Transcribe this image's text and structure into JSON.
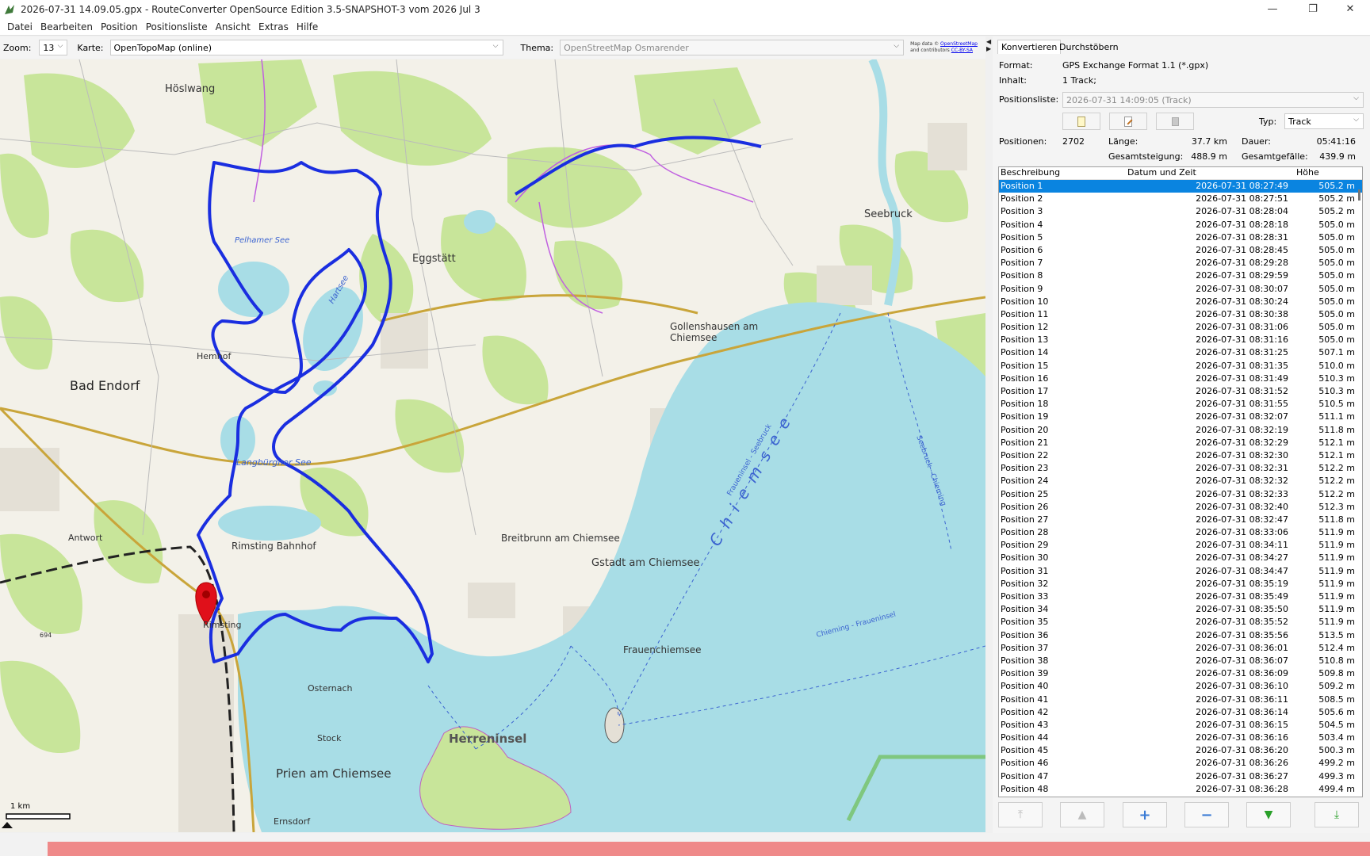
{
  "window": {
    "title": "2026-07-31 14.09.05.gpx - RouteConverter OpenSource Edition 3.5-SNAPSHOT-3 vom 2026 Jul 3",
    "minimize": "—",
    "maximize": "❐",
    "close": "✕"
  },
  "menu": [
    "Datei",
    "Bearbeiten",
    "Position",
    "Positionsliste",
    "Ansicht",
    "Extras",
    "Hilfe"
  ],
  "map_toolbar": {
    "zoom_label": "Zoom:",
    "zoom_value": "13",
    "karte_label": "Karte:",
    "karte_value": "OpenTopoMap (online)",
    "thema_label": "Thema:",
    "thema_value": "OpenStreetMap Osmarender",
    "attribution_line1": "Map data ©",
    "attribution_link1": "OpenStreetMap",
    "attribution_line2": "and contributors",
    "attribution_link2": "CC-BY-SA"
  },
  "map": {
    "scale_label": "1 km",
    "labels": {
      "hoeslwang": "Höslwang",
      "pelhamer": "Pelhamer See",
      "hartsee": "Hartsee",
      "eggstaett": "Eggstätt",
      "seebruck": "Seebruck",
      "gollenshausen1": "Gollenshausen am",
      "gollenshausen2": "Chiemsee",
      "hemhof": "Hemhof",
      "bad_endorf": "Bad Endorf",
      "langbuergner": "Langbürgner See",
      "antwort": "Antwort",
      "rimsting_bf": "Rimsting Bahnhof",
      "breitbrunn": "Breitbrunn am Chiemsee",
      "gstadt": "Gstadt am Chiemsee",
      "rimsting": "Rimsting",
      "frauenchiemsee": "Frauenchiemsee",
      "osternach": "Osternach",
      "herreninsel": "Herreninsel",
      "stock": "Stock",
      "prien": "Prien am Chiemsee",
      "ernsdorf": "Ernsdorf",
      "chiemsee": "Chiemsee",
      "frauenins_seebruck": "Fraueninsel - Seebruck",
      "seebruck_chieming": "Seebruck - Chieming",
      "chieming_frauenins": "Chieming - Fraueninsel",
      "alt694": "694"
    }
  },
  "panel": {
    "tab_konvertieren": "Konvertieren",
    "tab_durchstoebern": "Durchstöbern",
    "format_label": "Format:",
    "format_value": "GPS Exchange Format 1.1 (*.gpx)",
    "inhalt_label": "Inhalt:",
    "inhalt_value": "1 Track;",
    "positionsliste_label": "Positionsliste:",
    "positionsliste_value": "2026-07-31 14:09:05 (Track)",
    "typ_label": "Typ:",
    "typ_value": "Track",
    "positionen_label": "Positionen:",
    "positionen_value": "2702",
    "laenge_label": "Länge:",
    "laenge_value": "37.7 km",
    "dauer_label": "Dauer:",
    "dauer_value": "05:41:16",
    "steigung_label": "Gesamtsteigung:",
    "steigung_value": "488.9 m",
    "gefaelle_label": "Gesamtgefälle:",
    "gefaelle_value": "439.9 m"
  },
  "table": {
    "headers": [
      "Beschreibung",
      "Datum und Zeit",
      "Höhe"
    ],
    "rows": [
      [
        "Position 1",
        "2026-07-31 08:27:49",
        "505.2 m"
      ],
      [
        "Position 2",
        "2026-07-31 08:27:51",
        "505.2 m"
      ],
      [
        "Position 3",
        "2026-07-31 08:28:04",
        "505.2 m"
      ],
      [
        "Position 4",
        "2026-07-31 08:28:18",
        "505.0 m"
      ],
      [
        "Position 5",
        "2026-07-31 08:28:31",
        "505.0 m"
      ],
      [
        "Position 6",
        "2026-07-31 08:28:45",
        "505.0 m"
      ],
      [
        "Position 7",
        "2026-07-31 08:29:28",
        "505.0 m"
      ],
      [
        "Position 8",
        "2026-07-31 08:29:59",
        "505.0 m"
      ],
      [
        "Position 9",
        "2026-07-31 08:30:07",
        "505.0 m"
      ],
      [
        "Position 10",
        "2026-07-31 08:30:24",
        "505.0 m"
      ],
      [
        "Position 11",
        "2026-07-31 08:30:38",
        "505.0 m"
      ],
      [
        "Position 12",
        "2026-07-31 08:31:06",
        "505.0 m"
      ],
      [
        "Position 13",
        "2026-07-31 08:31:16",
        "505.0 m"
      ],
      [
        "Position 14",
        "2026-07-31 08:31:25",
        "507.1 m"
      ],
      [
        "Position 15",
        "2026-07-31 08:31:35",
        "510.0 m"
      ],
      [
        "Position 16",
        "2026-07-31 08:31:49",
        "510.3 m"
      ],
      [
        "Position 17",
        "2026-07-31 08:31:52",
        "510.3 m"
      ],
      [
        "Position 18",
        "2026-07-31 08:31:55",
        "510.5 m"
      ],
      [
        "Position 19",
        "2026-07-31 08:32:07",
        "511.1 m"
      ],
      [
        "Position 20",
        "2026-07-31 08:32:19",
        "511.8 m"
      ],
      [
        "Position 21",
        "2026-07-31 08:32:29",
        "512.1 m"
      ],
      [
        "Position 22",
        "2026-07-31 08:32:30",
        "512.1 m"
      ],
      [
        "Position 23",
        "2026-07-31 08:32:31",
        "512.2 m"
      ],
      [
        "Position 24",
        "2026-07-31 08:32:32",
        "512.2 m"
      ],
      [
        "Position 25",
        "2026-07-31 08:32:33",
        "512.2 m"
      ],
      [
        "Position 26",
        "2026-07-31 08:32:40",
        "512.3 m"
      ],
      [
        "Position 27",
        "2026-07-31 08:32:47",
        "511.8 m"
      ],
      [
        "Position 28",
        "2026-07-31 08:33:06",
        "511.9 m"
      ],
      [
        "Position 29",
        "2026-07-31 08:34:11",
        "511.9 m"
      ],
      [
        "Position 30",
        "2026-07-31 08:34:27",
        "511.9 m"
      ],
      [
        "Position 31",
        "2026-07-31 08:34:47",
        "511.9 m"
      ],
      [
        "Position 32",
        "2026-07-31 08:35:19",
        "511.9 m"
      ],
      [
        "Position 33",
        "2026-07-31 08:35:49",
        "511.9 m"
      ],
      [
        "Position 34",
        "2026-07-31 08:35:50",
        "511.9 m"
      ],
      [
        "Position 35",
        "2026-07-31 08:35:52",
        "511.9 m"
      ],
      [
        "Position 36",
        "2026-07-31 08:35:56",
        "513.5 m"
      ],
      [
        "Position 37",
        "2026-07-31 08:36:01",
        "512.4 m"
      ],
      [
        "Position 38",
        "2026-07-31 08:36:07",
        "510.8 m"
      ],
      [
        "Position 39",
        "2026-07-31 08:36:09",
        "509.8 m"
      ],
      [
        "Position 40",
        "2026-07-31 08:36:10",
        "509.2 m"
      ],
      [
        "Position 41",
        "2026-07-31 08:36:11",
        "508.5 m"
      ],
      [
        "Position 42",
        "2026-07-31 08:36:14",
        "505.6 m"
      ],
      [
        "Position 43",
        "2026-07-31 08:36:15",
        "504.5 m"
      ],
      [
        "Position 44",
        "2026-07-31 08:36:16",
        "503.4 m"
      ],
      [
        "Position 45",
        "2026-07-31 08:36:20",
        "500.3 m"
      ],
      [
        "Position 46",
        "2026-07-31 08:36:26",
        "499.2 m"
      ],
      [
        "Position 47",
        "2026-07-31 08:36:27",
        "499.3 m"
      ],
      [
        "Position 48",
        "2026-07-31 08:36:28",
        "499.4 m"
      ]
    ]
  },
  "colors": {
    "water": "#a8dde6",
    "forest": "#c8e59a",
    "track": "#1a2ee0",
    "selection": "#0a84e0",
    "marker": "#e0101a"
  }
}
